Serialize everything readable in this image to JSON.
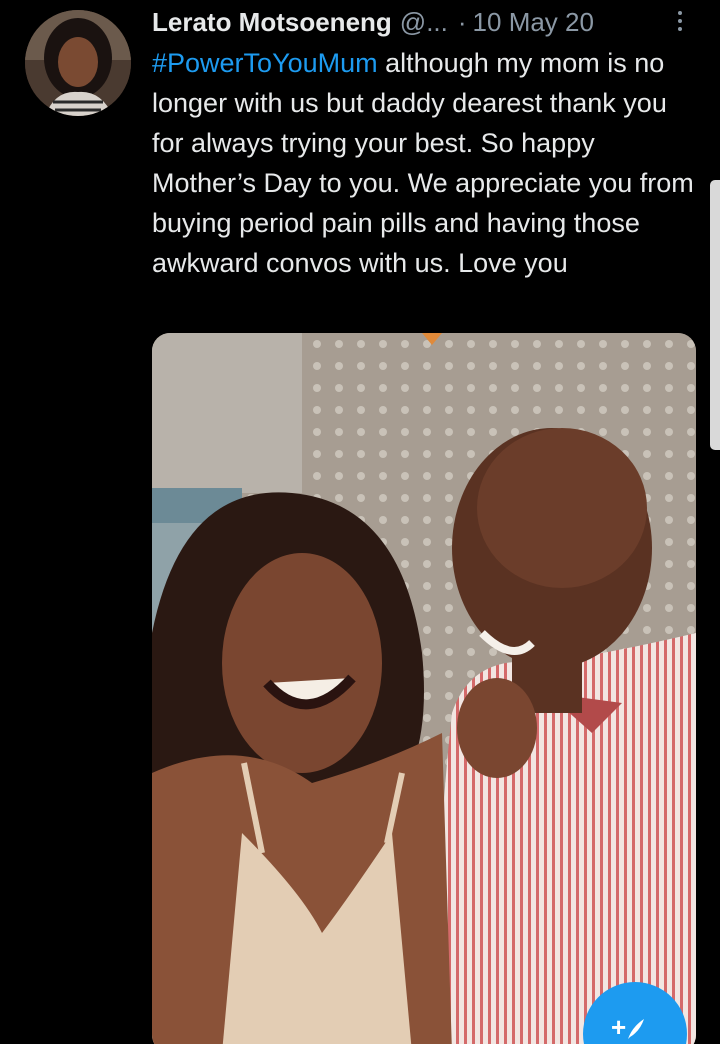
{
  "tweet": {
    "author": {
      "display_name": "Lerato Motsoeneng",
      "handle": "@...",
      "avatar_icon": "profile-photo"
    },
    "separator": "·",
    "date": "10 May 20",
    "more_icon": "more-vertical-icon",
    "hashtag": "#PowerToYouMum",
    "text": " although my mom is no longer with us but daddy dearest thank you for always trying your best. So happy Mother’s Day to you. We appreciate you from buying period pain pills and having those awkward convos with us. Love you",
    "media": {
      "type": "photo",
      "description_icon": "photo-image"
    }
  },
  "compose_button": {
    "label": "+",
    "icon": "feather-compose-icon"
  },
  "colors": {
    "background": "#000000",
    "text_primary": "#e7e9ea",
    "text_secondary": "#8b98a5",
    "accent": "#1d9bf0"
  }
}
